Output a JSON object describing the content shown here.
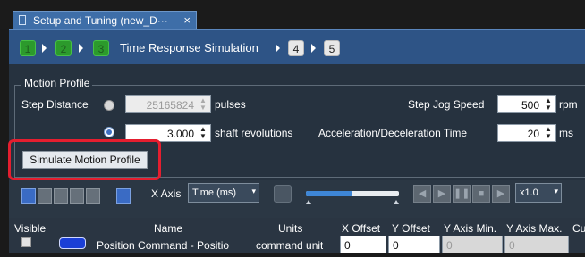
{
  "tab": {
    "title": "Setup and Tuning (new_D···",
    "close": "×"
  },
  "steps": {
    "s1": "1",
    "s2": "2",
    "s3": "3",
    "current_title": "Time Response Simulation",
    "s4": "4",
    "s5": "5"
  },
  "motion_profile": {
    "group_title": "Motion Profile",
    "step_distance_label": "Step Distance",
    "step_distance_value": "25165824",
    "step_distance_unit": "pulses",
    "shaft_value": "3.000",
    "shaft_unit": "shaft revolutions",
    "jog_speed_label": "Step Jog Speed",
    "jog_speed_value": "500",
    "jog_speed_unit": "rpm",
    "accel_label": "Acceleration/Deceleration Time",
    "accel_value": "20",
    "accel_unit": "ms",
    "simulate_button": "Simulate Motion Profile"
  },
  "toolbar": {
    "x_axis_label": "X Axis",
    "x_axis_value": "Time (ms)",
    "zoom_value": "x1.0",
    "dropdown_arrow": "▾"
  },
  "table": {
    "headers": {
      "visible": "Visible",
      "name": "Name",
      "units": "Units",
      "x_offset": "X Offset",
      "y_offset": "Y Offset",
      "y_min": "Y Axis Min.",
      "y_max": "Y Axis Max.",
      "extra": "Cu"
    },
    "row1": {
      "name": "Position Command - Positio",
      "units": "command unit",
      "x_offset": "0",
      "y_offset": "0",
      "y_min": "0",
      "y_max": "0"
    }
  },
  "colors": {
    "accent_red": "#e41e2f",
    "step_green": "#2c9a2c",
    "series_blue": "#1b3fd6"
  }
}
